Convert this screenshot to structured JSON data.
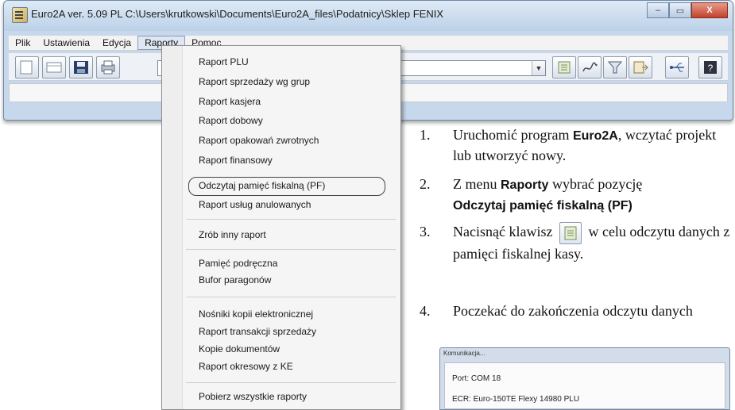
{
  "window": {
    "title": "Euro2A ver. 5.09 PL   C:\\Users\\krutkowski\\Documents\\Euro2A_files\\Podatnicy\\Sklep FENIX",
    "controls": {
      "minimize": "–",
      "maximize": "▭",
      "close": "X"
    }
  },
  "menubar": {
    "items": [
      "Plik",
      "Ustawienia",
      "Edycja",
      "Raporty",
      "Pomoc"
    ],
    "active": "Raporty"
  },
  "dropdown": {
    "items": [
      "Raport PLU",
      "Raport sprzedaży wg grup",
      "Raport kasjera",
      "Raport dobowy",
      "Raport opakowań zwrotnych",
      "Raport finansowy",
      "Odczytaj pamięć fiskalną (PF)",
      "Raport usług anulowanych",
      "Zrób inny raport",
      "Pamięć podręczna",
      "Bufor paragonów",
      "Nośniki kopii elektronicznej",
      "Raport transakcji sprzedaży",
      "Kopie dokumentów",
      "Raport okresowy z KE",
      "Pobierz wszystkie raporty"
    ],
    "highlighted": "Odczytaj pamięć fiskalną (PF)"
  },
  "steps": [
    {
      "num": "1.",
      "text_a": "Uruchomić program ",
      "bold_a": "Euro2A",
      "text_b": ", wczytać projekt lub utworzyć nowy."
    },
    {
      "num": "2.",
      "text_a": "Z menu ",
      "bold_a": "Raporty",
      "text_b": "  wybrać pozycję ",
      "bold_b": "Odczytaj pamięć fiskalną (PF)"
    },
    {
      "num": "3.",
      "text_a": "Nacisnąć klawisz ",
      "text_b": " w celu odczytu danych z pamięci fiskalnej kasy."
    },
    {
      "num": "4.",
      "text_a": "Poczekać do zakończenia odczytu danych"
    }
  ],
  "dialog": {
    "title": "Komunikacja...",
    "port": "Port: COM 18",
    "ecr": "ECR: Euro-150TE Flexy 14980 PLU"
  },
  "icons": [
    "app-icon",
    "new-file-icon",
    "blank-doc-icon",
    "save-icon",
    "print-icon",
    "read-fiscal-icon",
    "signature-icon",
    "filter-icon",
    "export-icon",
    "usb-icon",
    "help-icon"
  ]
}
